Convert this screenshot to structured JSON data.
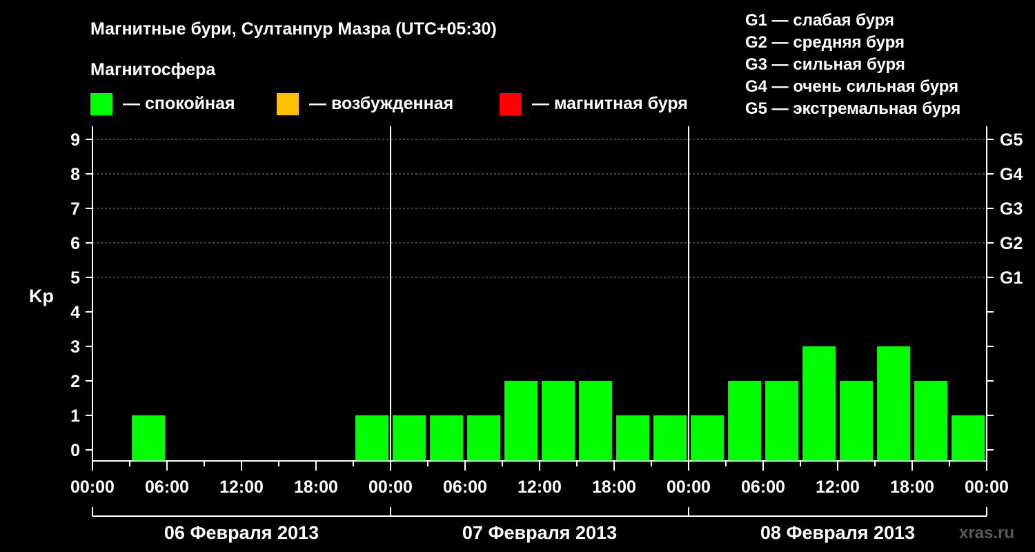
{
  "chart_data": {
    "type": "bar",
    "title": "Магнитные бури, Султанпур Мазра (UTC+05:30)",
    "ylabel": "Kp",
    "ylim": [
      0,
      9
    ],
    "yticks": [
      "0",
      "1",
      "2",
      "3",
      "4",
      "5",
      "6",
      "7",
      "8",
      "9"
    ],
    "right_axis_ticks": [
      {
        "kp": 5,
        "label": "G1"
      },
      {
        "kp": 6,
        "label": "G2"
      },
      {
        "kp": 7,
        "label": "G3"
      },
      {
        "kp": 8,
        "label": "G4"
      },
      {
        "kp": 9,
        "label": "G5"
      }
    ],
    "dashed_grid_levels": [
      5,
      6,
      7,
      8,
      9
    ],
    "x_tick_labels": [
      "00:00",
      "06:00",
      "12:00",
      "18:00",
      "00:00",
      "06:00",
      "12:00",
      "18:00",
      "00:00",
      "06:00",
      "12:00",
      "18:00",
      "00:00"
    ],
    "day_labels": [
      "06 Февраля 2013",
      "07 Февраля 2013",
      "08 Февраля 2013"
    ],
    "interval_hours": 3,
    "series": [
      {
        "values": [
          0,
          0,
          1,
          0,
          0,
          0,
          0,
          0,
          1,
          1,
          1,
          1,
          2,
          2,
          2,
          1,
          1,
          1,
          2,
          2,
          3,
          2,
          3,
          2,
          1
        ]
      }
    ],
    "colors": {
      "calm": "#00ff00",
      "excited": "#ffc000",
      "storm": "#ff0000"
    }
  },
  "legend": {
    "heading": "Магнитосфера",
    "items": [
      {
        "color": "#00ff00",
        "label": "— спокойная"
      },
      {
        "color": "#ffc000",
        "label": "— возбужденная"
      },
      {
        "color": "#ff0000",
        "label": "— магнитная буря"
      }
    ]
  },
  "g_scale": [
    "G1 — слабая буря",
    "G2 — средняя буря",
    "G3 — сильная буря",
    "G4 — очень сильная буря",
    "G5 — экстремальная буря"
  ],
  "watermark": "xras.ru"
}
